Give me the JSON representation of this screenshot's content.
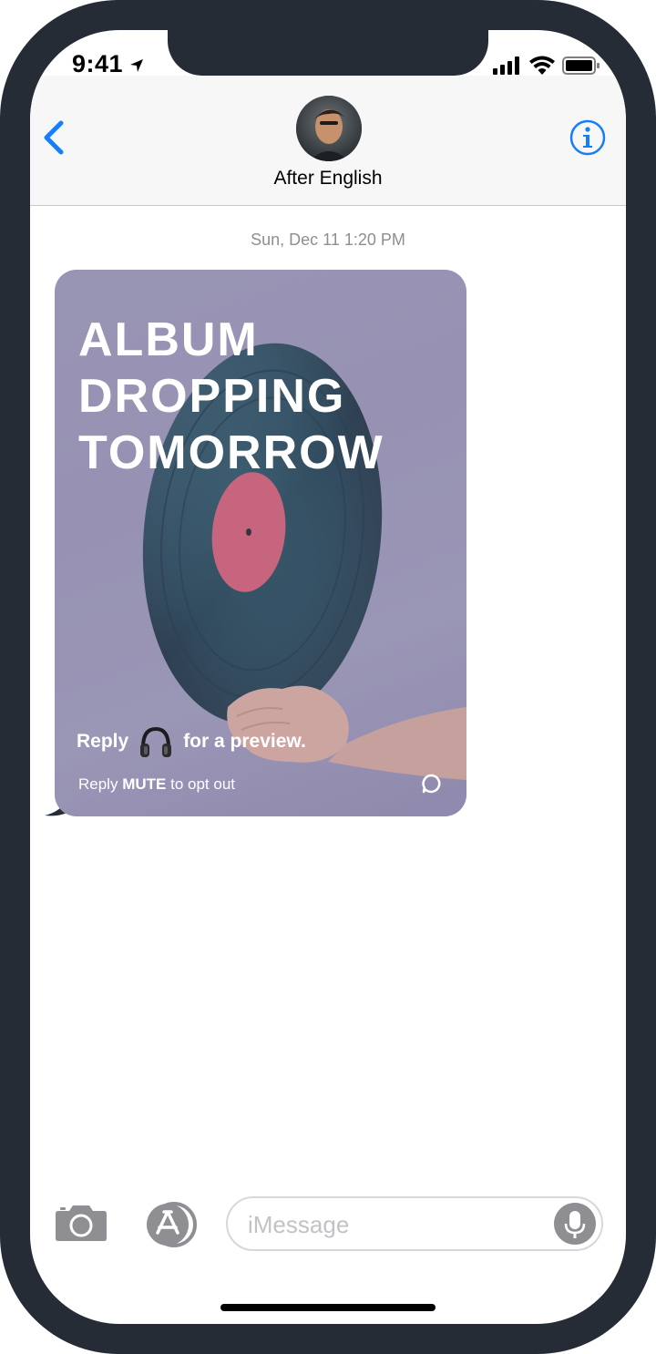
{
  "status_bar": {
    "time": "9:41",
    "icons": [
      "location-arrow-icon",
      "cellular-signal-icon",
      "wifi-icon",
      "battery-icon"
    ]
  },
  "nav": {
    "contact_name": "After English",
    "back_icon": "chevron-left-icon",
    "info_icon": "info-icon",
    "accent_color": "#147efb"
  },
  "conversation": {
    "timestamp": "Sun, Dec 11 1:20 PM",
    "message": {
      "headline": [
        "ALBUM",
        "DROPPING",
        "TOMORROW"
      ],
      "reply_prefix": "Reply",
      "reply_icon": "headphones-icon",
      "reply_suffix": "for a preview.",
      "optout_prefix": "Reply",
      "optout_keyword": "MUTE",
      "optout_suffix": "to opt out",
      "badge_icon": "chat-bubble-icon"
    }
  },
  "input_bar": {
    "camera_icon": "camera-icon",
    "appstore_icon": "app-store-icon",
    "placeholder": "iMessage",
    "mic_icon": "microphone-icon"
  }
}
